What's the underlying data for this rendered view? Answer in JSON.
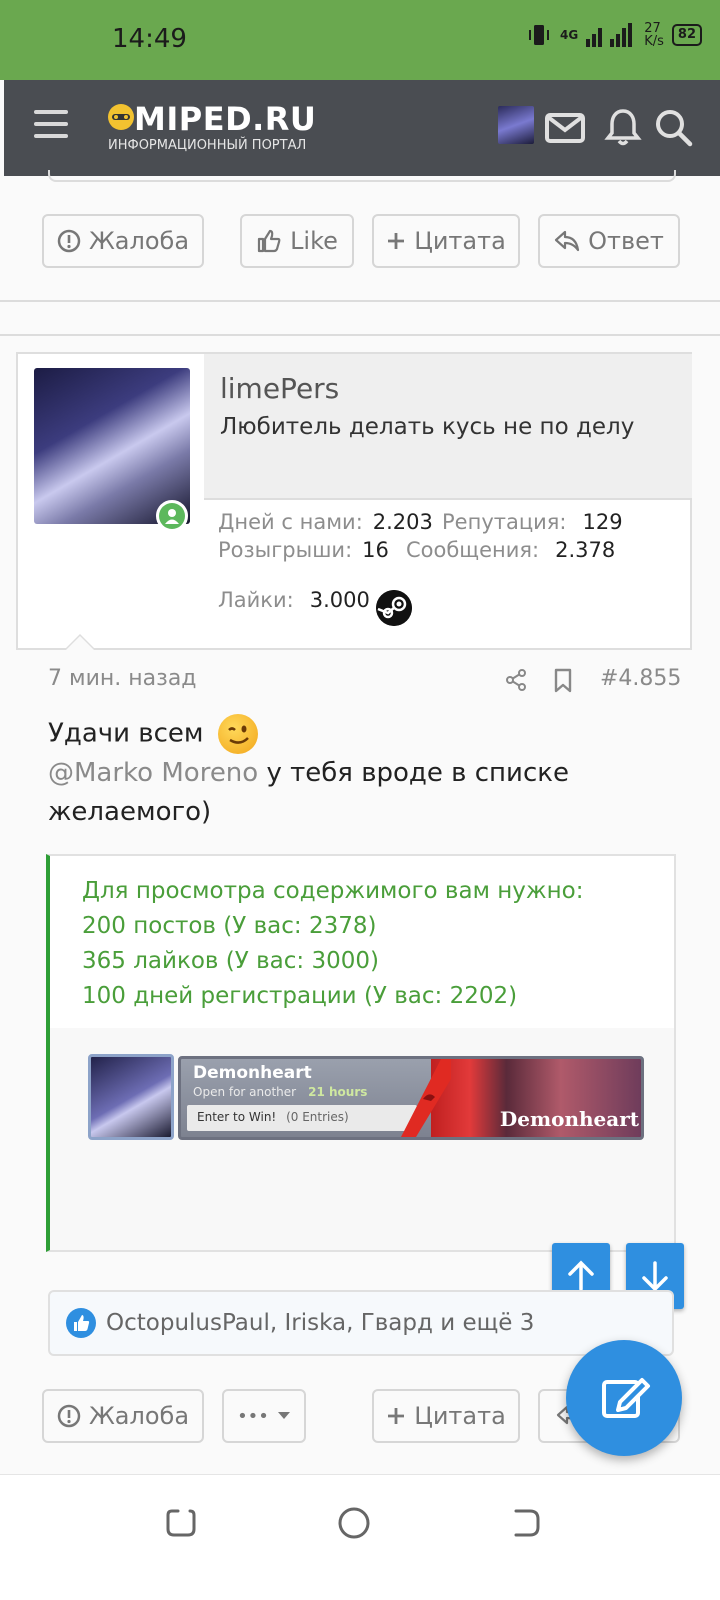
{
  "status_bar": {
    "time": "14:49",
    "network": "4G",
    "speed": "27",
    "speed_unit": "K/s",
    "battery": "82"
  },
  "header": {
    "logo_name": "MIPED.RU",
    "logo_subtitle": "ИНФОРМАЦИОННЫЙ ПОРТАЛ"
  },
  "top_actions": {
    "report": "Жалоба",
    "like": "Like",
    "quote": "Цитата",
    "reply": "Ответ"
  },
  "user": {
    "name": "limePers",
    "title": "Любитель делать кусь не по делу",
    "stats": {
      "days_label": "Дней с нами:",
      "days_value": "2.203",
      "rep_label": "Репутация:",
      "rep_value": "129",
      "raffles_label": "Розыгрыши:",
      "raffles_value": "16",
      "messages_label": "Сообщения:",
      "messages_value": "2.378",
      "likes_label": "Лайки:",
      "likes_value": "3.000"
    }
  },
  "post": {
    "time": "7 мин. назад",
    "number": "#4.855",
    "line1": "Удачи всем",
    "mention": "@Marko Moreno",
    "line2": " у тебя вроде в списке желаемого)"
  },
  "hidden": {
    "title": "Для просмотра содержимого вам нужно:",
    "req1": "200 постов (У вас: 2378)",
    "req2": "365 лайков (У вас: 3000)",
    "req3": "100 дней регистрации (У вас: 2202)"
  },
  "giveaway": {
    "title": "Demonheart",
    "open_text": "Open for another",
    "open_time": "21 hours",
    "enter": "Enter to Win!",
    "entries": "(0 Entries)",
    "art_label": "Demonheart"
  },
  "reactions": {
    "text": "OctopulusPaul, Iriska, Гвард и ещё 3"
  },
  "bottom_actions": {
    "report": "Жалоба",
    "more": "•••",
    "quote": "Цитата"
  },
  "colors": {
    "status_bar": "#6aa84f",
    "app_bar": "#4a4d52",
    "accent": "#2f8fe0",
    "requirement_green": "#4a9e3a"
  }
}
